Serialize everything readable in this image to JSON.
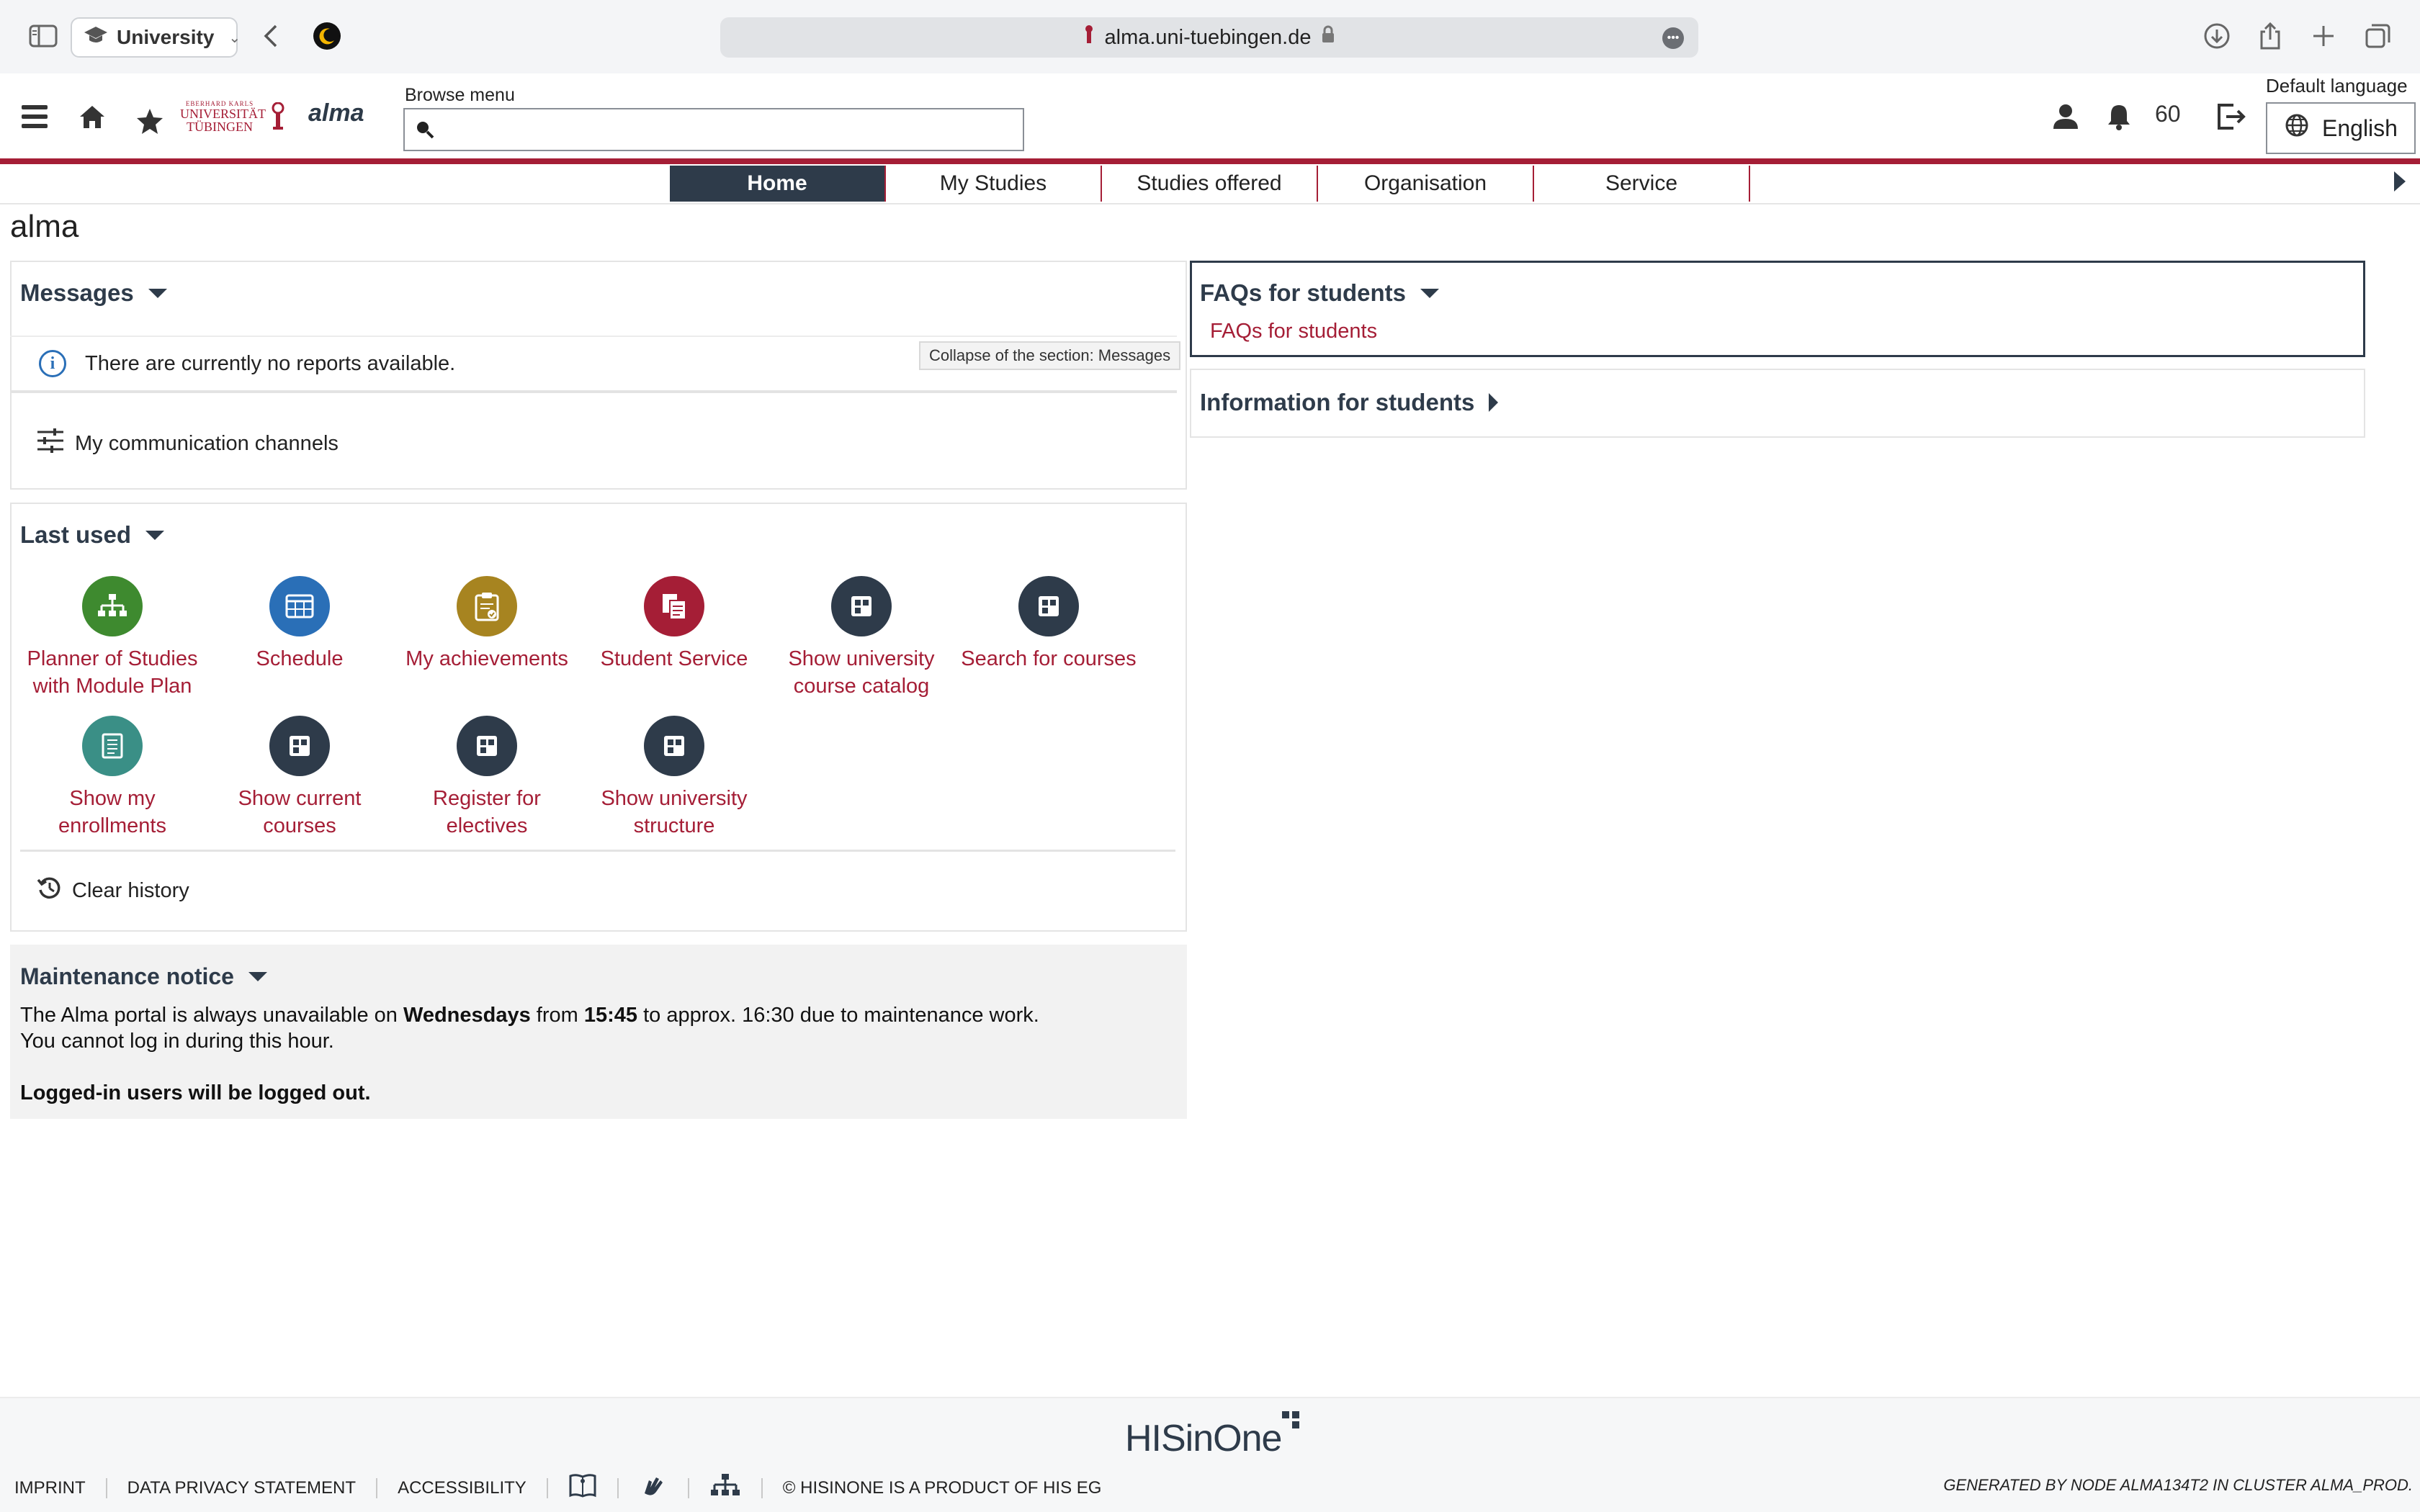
{
  "browser": {
    "tab_group": "University",
    "url": "alma.uni-tuebingen.de"
  },
  "header": {
    "logo_line1": "EBERHARD KARLS",
    "logo_line2": "UNIVERSITÄT",
    "logo_line3": "TÜBINGEN",
    "app_logo": "alma",
    "browse_label": "Browse menu",
    "browse_value": "",
    "message_count": "60",
    "lang_label": "Default language",
    "lang_value": "English"
  },
  "nav": {
    "tabs": [
      {
        "label": "Home",
        "active": true
      },
      {
        "label": "My Studies",
        "active": false
      },
      {
        "label": "Studies offered",
        "active": false
      },
      {
        "label": "Organisation",
        "active": false
      },
      {
        "label": "Service",
        "active": false
      }
    ]
  },
  "page_title": "alma",
  "messages": {
    "title": "Messages",
    "empty_text": "There are currently no reports available.",
    "tooltip": "Collapse of the section: Messages",
    "channels": "My communication channels"
  },
  "last_used": {
    "title": "Last used",
    "tiles": [
      {
        "label": "Planner of Studies with Module Plan",
        "icon": "sitemap-icon",
        "color": "#3e8a2f"
      },
      {
        "label": "Schedule",
        "icon": "calendar-grid-icon",
        "color": "#2a6fb7"
      },
      {
        "label": "My achievements",
        "icon": "clipboard-check-icon",
        "color": "#a78420"
      },
      {
        "label": "Student Service",
        "icon": "documents-icon",
        "color": "#a51e36"
      },
      {
        "label": "Show university course catalog",
        "icon": "app-window-icon",
        "color": "#2e3b4a"
      },
      {
        "label": "Search for courses",
        "icon": "app-window-icon",
        "color": "#2e3b4a"
      },
      {
        "label": "Show my enrollments",
        "icon": "list-document-icon",
        "color": "#3a8f86"
      },
      {
        "label": "Show current courses",
        "icon": "app-window-icon",
        "color": "#2e3b4a"
      },
      {
        "label": "Register for electives",
        "icon": "app-window-icon",
        "color": "#2e3b4a"
      },
      {
        "label": "Show university structure",
        "icon": "app-window-icon",
        "color": "#2e3b4a"
      }
    ],
    "clear": "Clear history"
  },
  "maintenance": {
    "title": "Maintenance notice",
    "line1_a": "The Alma portal is always unavailable on ",
    "line1_b": "Wednesdays",
    "line1_c": " from ",
    "line1_d": "15:45",
    "line1_e": " to approx. 16:30 due to maintenance work.",
    "line2": "You cannot log in during this hour.",
    "line3": "Logged-in users will be logged out."
  },
  "faqs": {
    "title": "FAQs for students",
    "link": "FAQs for students"
  },
  "info": {
    "title": "Information for students"
  },
  "footer": {
    "brand": "HISinOne",
    "imprint": "IMPRINT",
    "privacy": "DATA PRIVACY STATEMENT",
    "accessibility": "ACCESSIBILITY",
    "copyright": "© HISINONE IS A PRODUCT OF HIS EG",
    "generated": "GENERATED BY NODE ALMA134T2 IN CLUSTER ALMA_PROD."
  }
}
